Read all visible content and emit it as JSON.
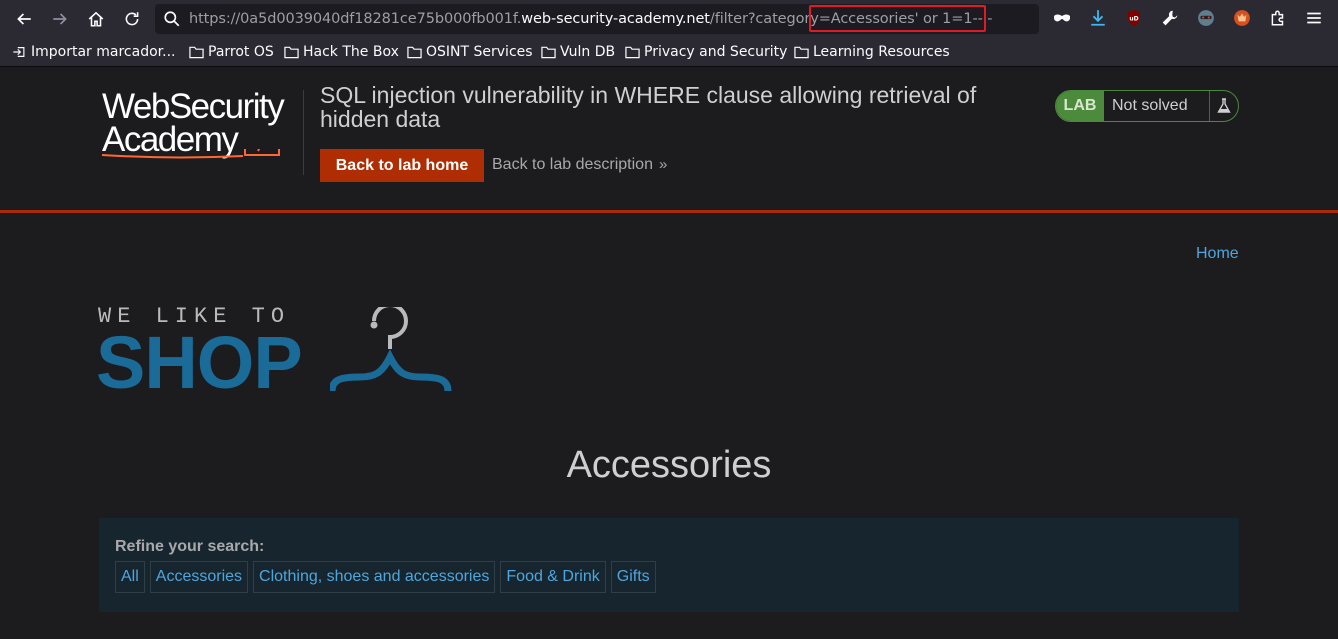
{
  "browser": {
    "url_prefix": "https://0a5d0039040df18281ce75b000fb001f.",
    "url_host": "web-security-academy.net",
    "url_path": "/filter?category=",
    "url_query_highlight": "Accessories' or 1=1-- -",
    "bookmarks": [
      {
        "label": "Importar marcador...",
        "icon": "import-icon"
      },
      {
        "label": "Parrot OS",
        "icon": "folder-icon"
      },
      {
        "label": "Hack The Box",
        "icon": "folder-icon"
      },
      {
        "label": "OSINT Services",
        "icon": "folder-icon"
      },
      {
        "label": "Vuln DB",
        "icon": "folder-icon"
      },
      {
        "label": "Privacy and Security",
        "icon": "folder-icon"
      },
      {
        "label": "Learning Resources",
        "icon": "folder-icon"
      }
    ]
  },
  "lab": {
    "logo_line1": "WebSecurity",
    "logo_line2": "Academy",
    "title": "SQL injection vulnerability in WHERE clause allowing retrieval of hidden data",
    "back_home": "Back to lab home",
    "back_description": "Back to lab description",
    "status_tag": "LAB",
    "status_text": "Not solved"
  },
  "shop": {
    "home_link": "Home",
    "logo_tagline": "WE LIKE TO",
    "logo_word": "SHOP",
    "category_title": "Accessories",
    "refine_label": "Refine your search:",
    "filters": [
      "All",
      "Accessories",
      "Clothing, shoes and accessories",
      "Food & Drink",
      "Gifts"
    ]
  },
  "colors": {
    "accent_orange": "#ae2d03",
    "link_blue": "#4fa5de",
    "shop_blue": "#1a6b98",
    "lab_green": "#4b8b3b",
    "highlight_red": "#e01b24"
  }
}
